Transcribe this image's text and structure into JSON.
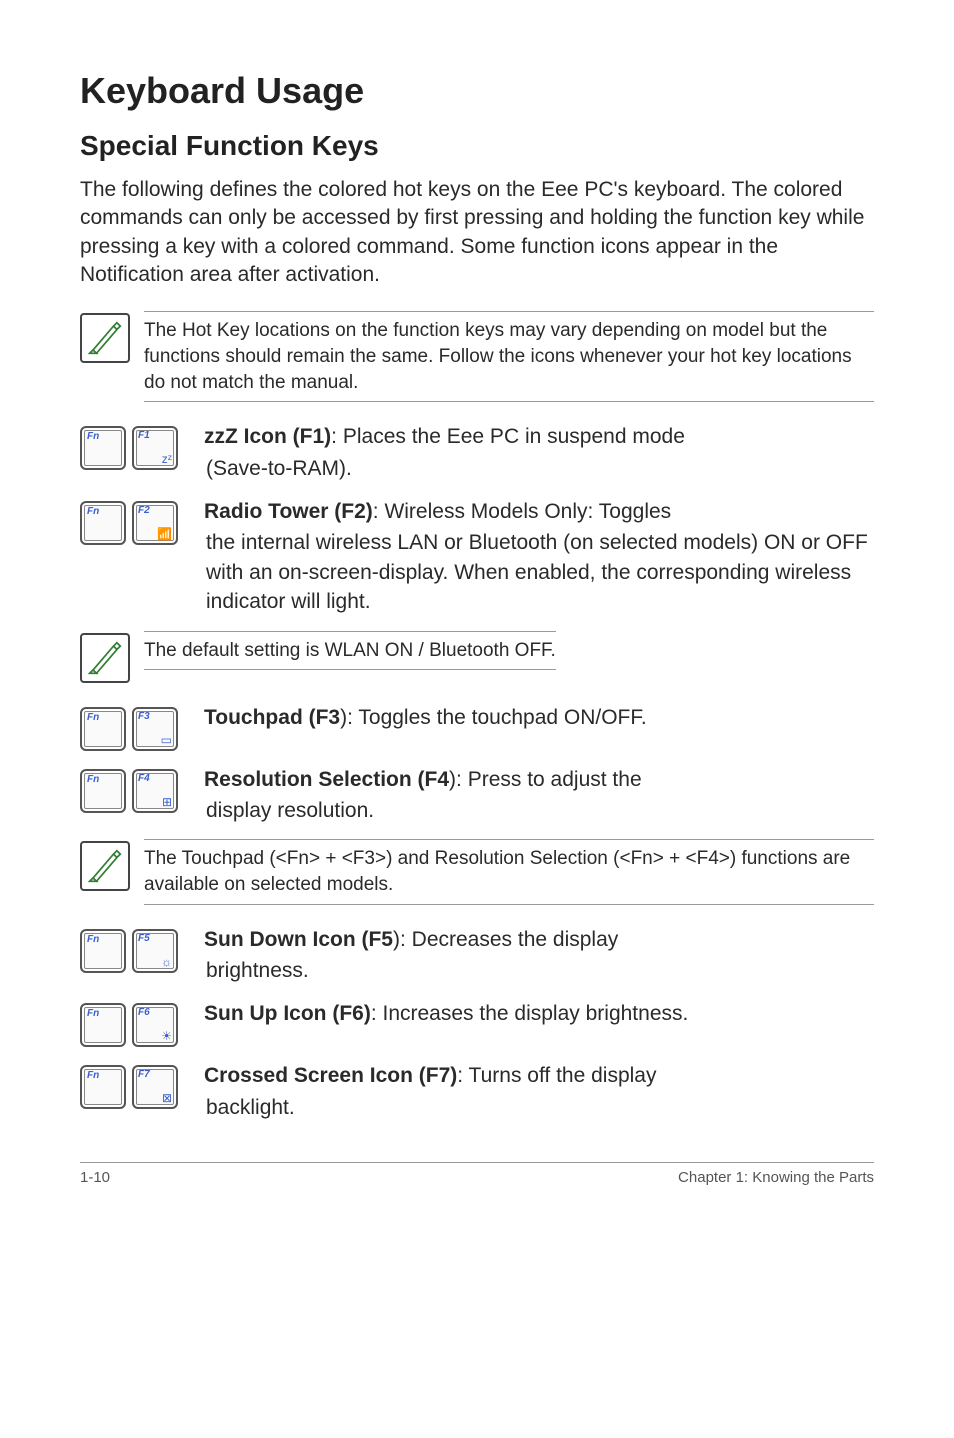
{
  "title": "Keyboard Usage",
  "subtitle": "Special Function Keys",
  "intro": "The following defines the colored hot keys on the Eee PC's keyboard. The colored commands can only be accessed by first pressing and holding the function key while pressing a key with a colored command. Some function icons appear in the Notification area after activation.",
  "note1": "The Hot Key locations on the function keys may vary depending on model but the functions should remain the same. Follow the icons whenever your hot key locations do not match the manual.",
  "keys": {
    "fn": "Fn",
    "f1": {
      "label": "F1",
      "sym": "zᶻ",
      "bold": "zzZ Icon (F1)",
      "text": ": Places the Eee PC in suspend mode",
      "sub": " (Save-to-RAM)."
    },
    "f2": {
      "label": "F2",
      "sym": "📶",
      "bold": "Radio Tower (F2)",
      "text": ": Wireless Models Only: Toggles",
      "sub": "the internal wireless LAN or Bluetooth (on selected models) ON or OFF with an on-screen-display. When enabled, the corresponding wireless indicator will light."
    },
    "f3": {
      "label": "F3",
      "sym": "▭",
      "bold": "Touchpad (F3",
      "text": "): Toggles the touchpad ON/OFF."
    },
    "f4": {
      "label": "F4",
      "sym": "⊞",
      "bold": "Resolution Selection (F4",
      "text": "): Press to adjust the",
      "sub": "display resolution."
    },
    "f5": {
      "label": "F5",
      "sym": "☼",
      "bold": "Sun Down Icon (F5",
      "text": "): Decreases the display",
      "sub": "brightness."
    },
    "f6": {
      "label": "F6",
      "sym": "☀",
      "bold": "Sun Up Icon (F6)",
      "text": ": Increases the display brightness."
    },
    "f7": {
      "label": "F7",
      "sym": "⊠",
      "bold": "Crossed Screen Icon (F7)",
      "text": ": Turns off the display",
      "sub": "backlight."
    }
  },
  "note2": "The default setting is WLAN ON / Bluetooth OFF.",
  "note3": "The Touchpad (<Fn> + <F3>) and Resolution Selection (<Fn> + <F4>) functions are available on selected models.",
  "footer": {
    "left": "1-10",
    "right": "Chapter 1: Knowing the Parts"
  }
}
